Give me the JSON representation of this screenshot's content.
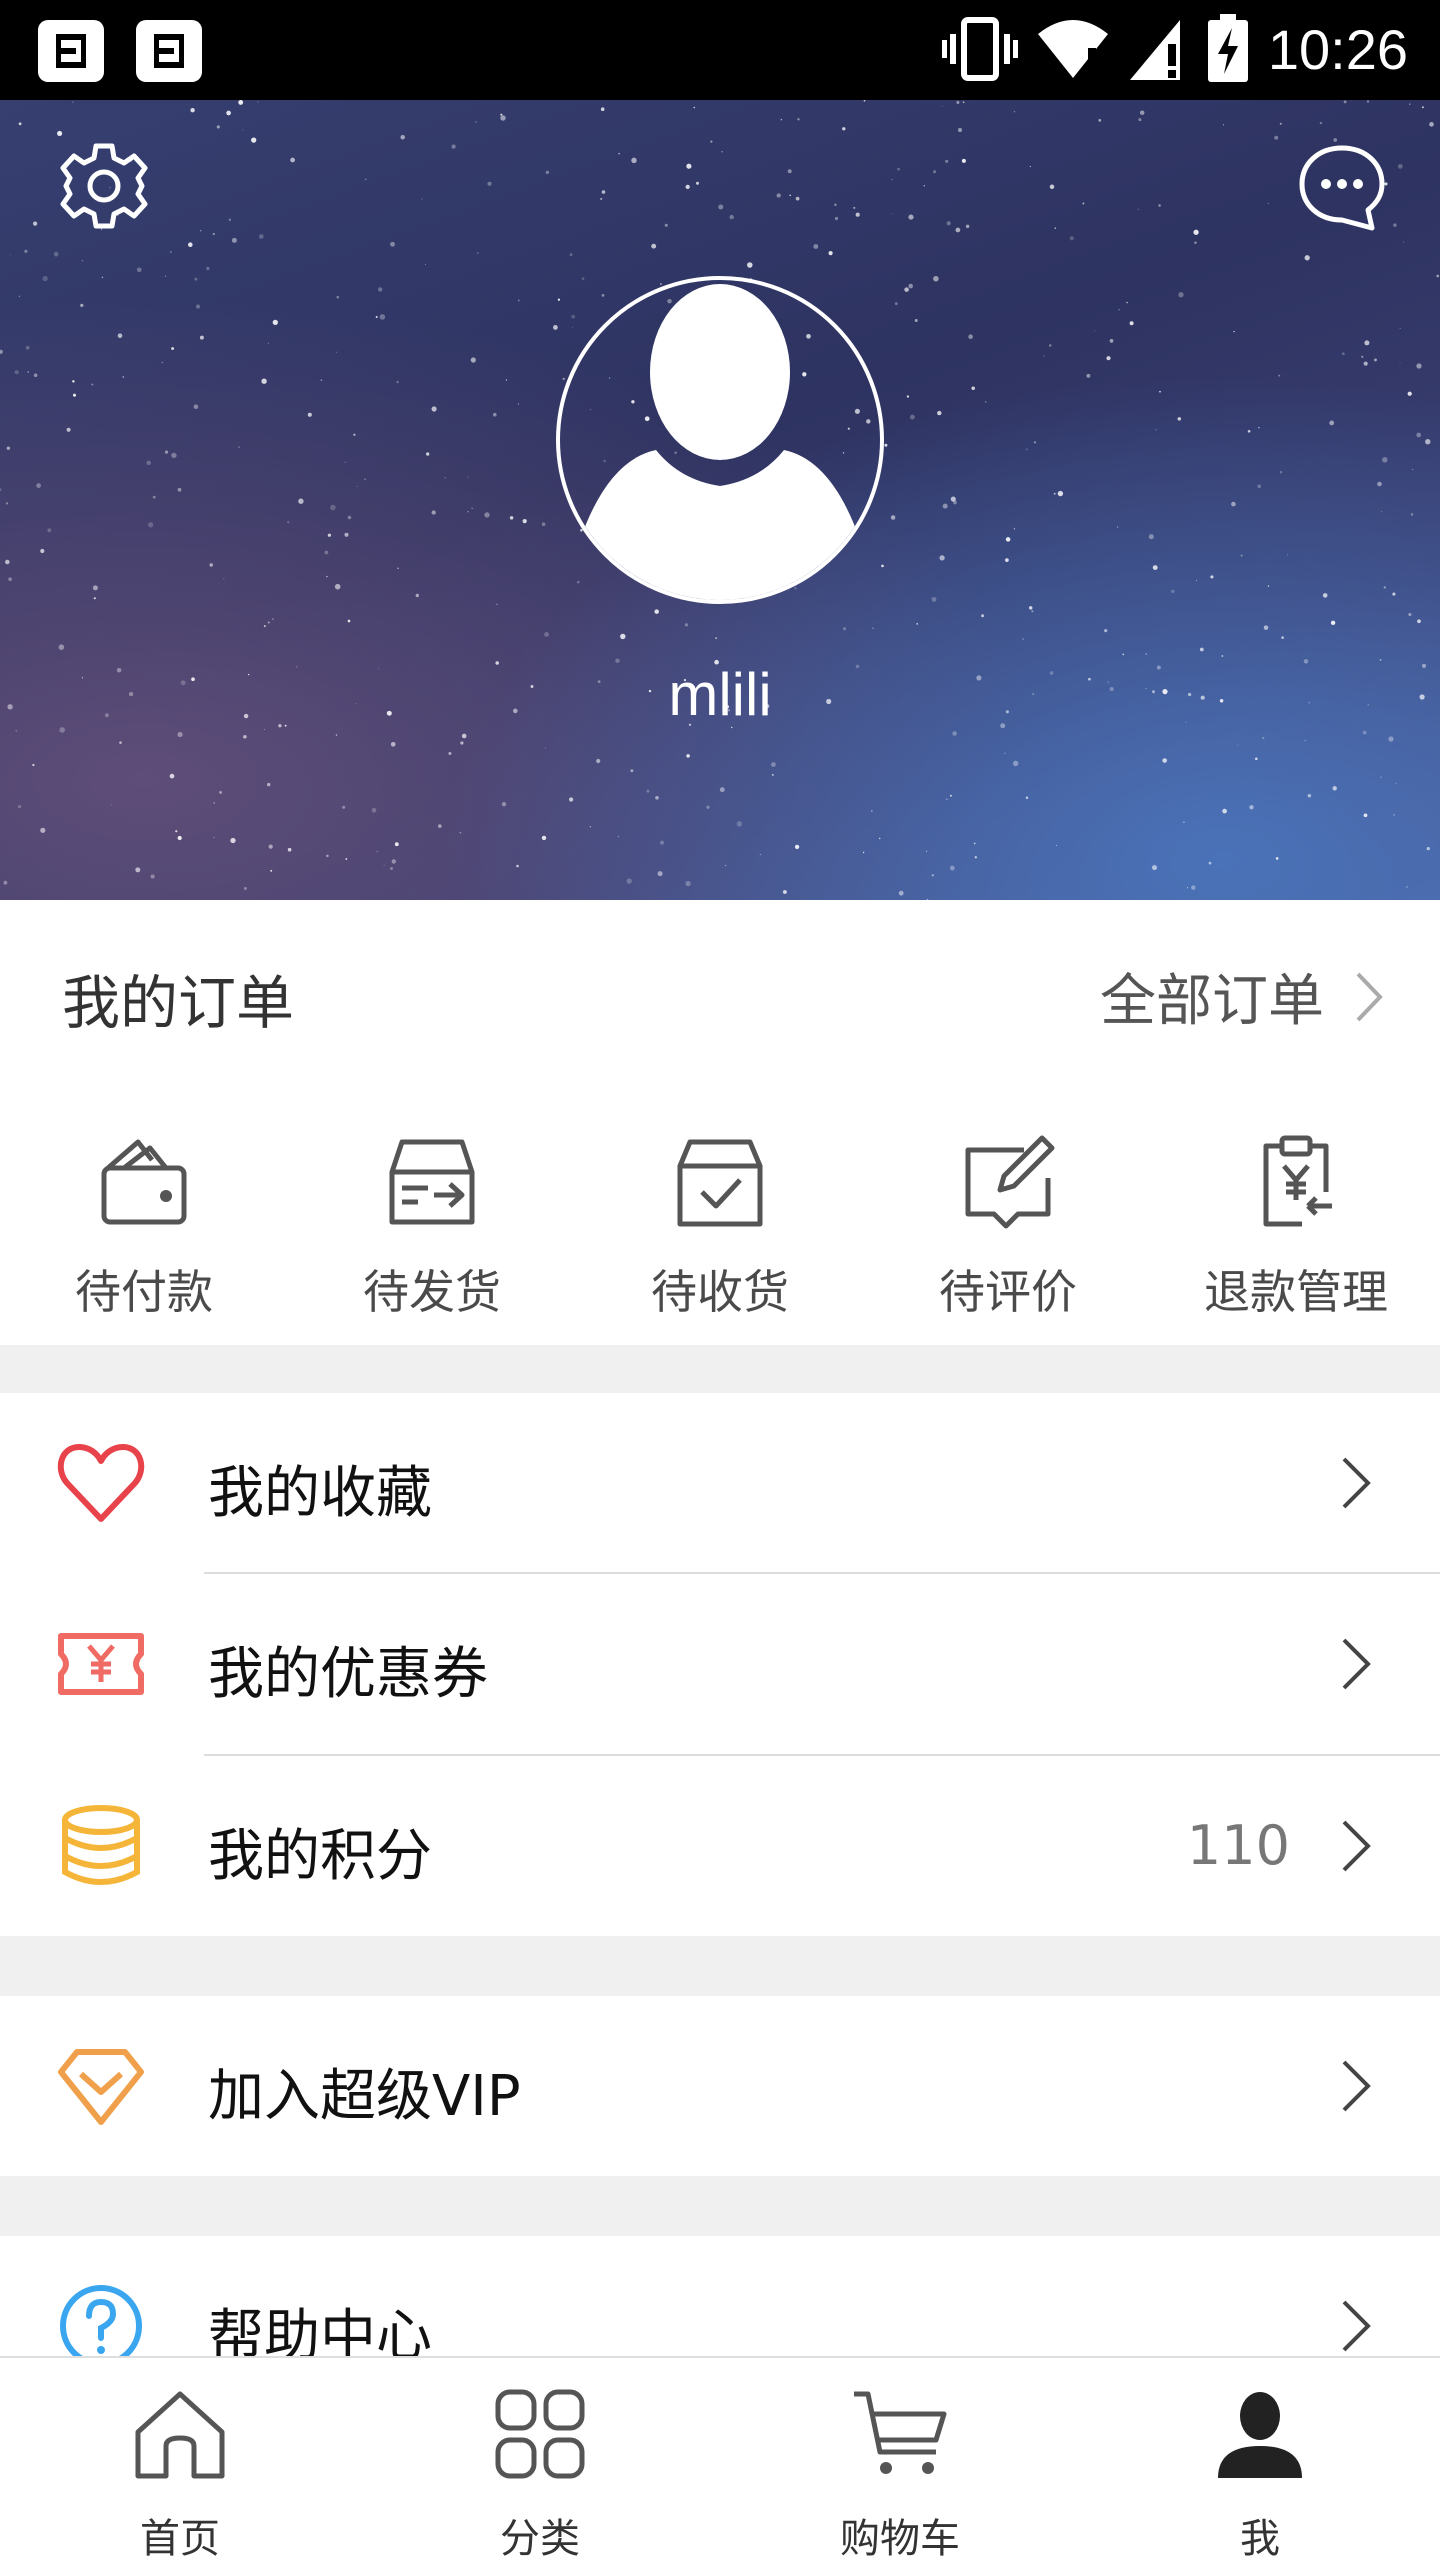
{
  "status_bar": {
    "time": "10:26",
    "icons": [
      "screenshot-icon",
      "screenshot-icon",
      "vibrate-icon",
      "wifi-icon",
      "signal-icon",
      "battery-charging-icon"
    ]
  },
  "header": {
    "username": "mlili",
    "icons": [
      "gear-icon",
      "message-icon",
      "avatar-placeholder"
    ]
  },
  "orders": {
    "title": "我的订单",
    "all_label": "全部订单",
    "items": [
      {
        "label": "待付款",
        "icon": "wallet-icon"
      },
      {
        "label": "待发货",
        "icon": "shipping-box-icon"
      },
      {
        "label": "待收货",
        "icon": "received-box-icon"
      },
      {
        "label": "待评价",
        "icon": "review-edit-icon"
      },
      {
        "label": "退款管理",
        "icon": "refund-clipboard-icon"
      }
    ]
  },
  "menu": {
    "favorites": {
      "label": "我的收藏",
      "icon": "heart-icon"
    },
    "coupons": {
      "label": "我的优惠券",
      "icon": "coupon-icon"
    },
    "points": {
      "label": "我的积分",
      "value": "110",
      "icon": "coins-icon"
    },
    "vip": {
      "label": "加入超级VIP",
      "icon": "diamond-icon"
    },
    "help": {
      "label": "帮助中心",
      "icon": "help-icon"
    }
  },
  "bottom_nav": {
    "items": [
      {
        "label": "首页",
        "icon": "home-icon"
      },
      {
        "label": "分类",
        "icon": "grid-icon"
      },
      {
        "label": "购物车",
        "icon": "cart-icon"
      },
      {
        "label": "我",
        "icon": "person-icon"
      }
    ]
  },
  "colors": {
    "heart": "#e8424a",
    "coupon": "#ef6b63",
    "coins": "#f5b538",
    "vip": "#f0a04a",
    "help": "#3aa6f0",
    "band": "#f0f0f0"
  }
}
